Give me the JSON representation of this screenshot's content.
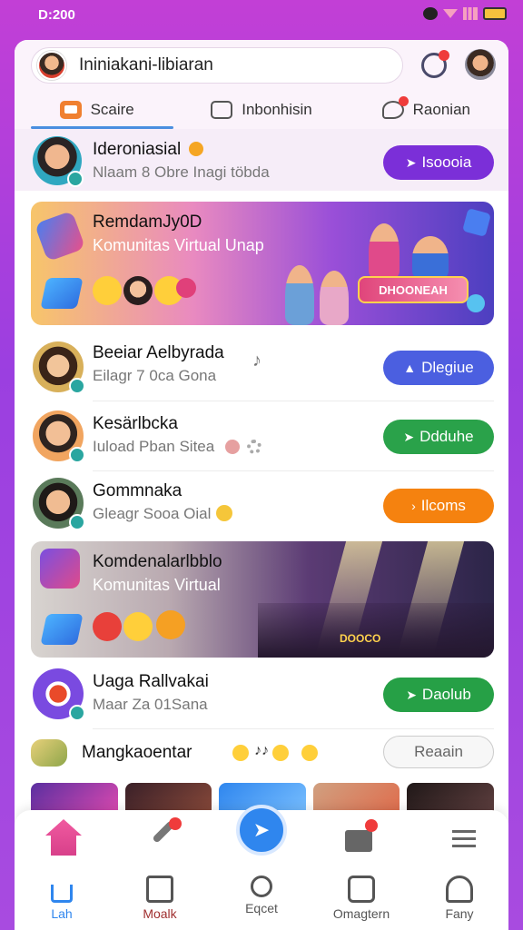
{
  "status": {
    "time": "D:200"
  },
  "header": {
    "search_text": "Ininiakani-libiaran",
    "tabs": [
      {
        "label": "Scaire",
        "active": true
      },
      {
        "label": "Inbonhisin",
        "active": false
      },
      {
        "label": "Raonian",
        "active": false
      }
    ]
  },
  "rows": [
    {
      "title": "Ideroniasial",
      "subtitle": "Nlaam 8 Obre Inagi töbda",
      "button": "Isoooia",
      "button_color": "#7b2fd8"
    },
    {
      "title": "Beeiar Aelbyrada",
      "subtitle": "Eilagr 7 0ca Gona",
      "button": "Dlegiue",
      "button_color": "#4b5fe0"
    },
    {
      "title": "Kesärlbcka",
      "subtitle": "Iuload Pban Sitea",
      "button": "Ddduhe",
      "button_color": "#2aa24a"
    },
    {
      "title": "Gommnaka",
      "subtitle": "Gleagr Sooa Oial",
      "button": "Ilcoms",
      "button_color": "#f5820f"
    },
    {
      "title": "Uaga Rallvakai",
      "subtitle": "Maar Za 01Sana",
      "button": "Daolub",
      "button_color": "#26a046"
    }
  ],
  "banners": [
    {
      "title": "RemdamJy0D",
      "subtitle": "Komunitas Virtual Unap",
      "sign": "DHOONEAH"
    },
    {
      "title": "Komdenalarlbblo",
      "subtitle": "Komunitas Virtual",
      "sign": "DOOCO"
    }
  ],
  "last_row": {
    "title": "Mangkaoentar",
    "button": "Reaain"
  },
  "nav": [
    {
      "label": "Lah",
      "icon": "home-icon"
    },
    {
      "label": "Moalk",
      "icon": "chart-icon"
    },
    {
      "label": "Eqcet",
      "icon": "search-icon"
    },
    {
      "label": "Omagtern",
      "icon": "grid-icon"
    },
    {
      "label": "Fany",
      "icon": "profile-icon"
    }
  ],
  "colors": {
    "accent": "#2f86ee",
    "bg_gradient_top": "#c23fd6",
    "bg_gradient_bottom": "#a84be0"
  }
}
